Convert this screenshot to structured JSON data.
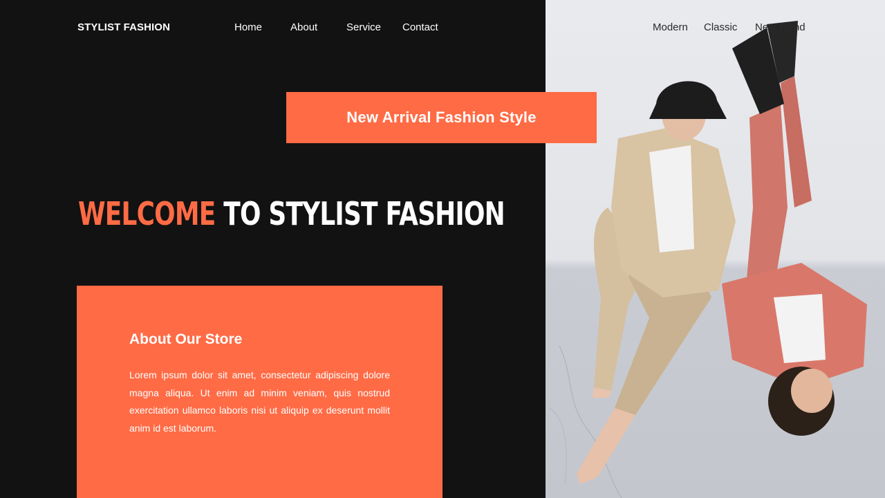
{
  "header": {
    "brand": "STYLIST FASHION",
    "nav": [
      "Home",
      "About",
      "Service",
      "Contact"
    ],
    "categories": [
      "Modern",
      "Classic",
      "New Trend"
    ]
  },
  "hero": {
    "banner": "New Arrival Fashion Style",
    "headline_accent": "WELCOME",
    "headline_rest": " TO STYLIST FASHION"
  },
  "about": {
    "title": "About Our Store",
    "body": "Lorem ipsum dolor sit amet, consectetur adipiscing dolore magna aliqua. Ut enim ad minim veniam, quis nostrud exercitation ullamco laboris nisi ut aliquip ex deserunt mollit anim id est laborum."
  },
  "colors": {
    "background": "#121212",
    "accent": "#ff6b45",
    "text": "#ffffff"
  }
}
